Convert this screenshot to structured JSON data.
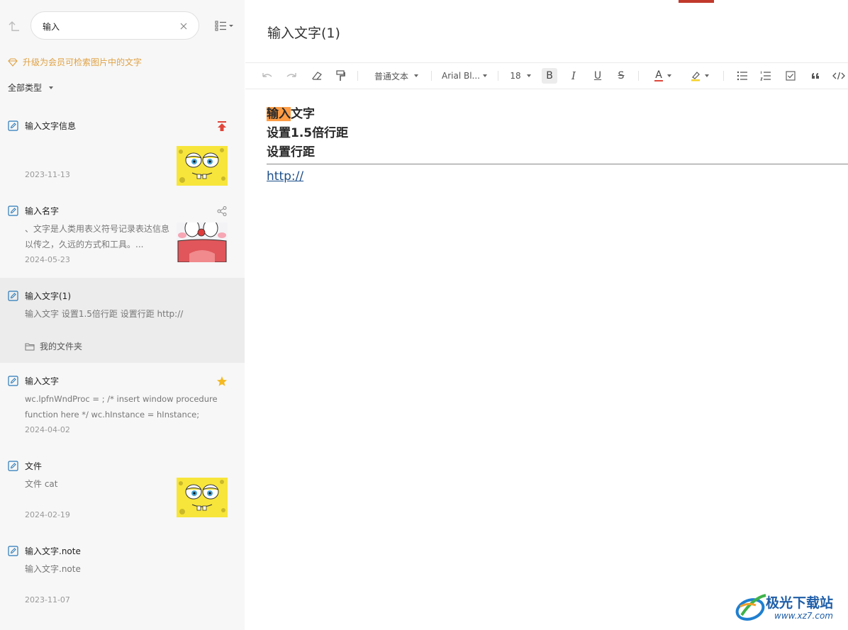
{
  "sidebar": {
    "search": {
      "value": "输入"
    },
    "upgrade_text": "升级为会员可检索图片中的文字",
    "type_filter": "全部类型",
    "notes": [
      {
        "title": "输入文字信息",
        "snippet": "",
        "date": "2023-11-13",
        "thumb": "spongebob",
        "badge": "pin-top-icon"
      },
      {
        "title": "输入名字",
        "snippet": "、文字是人类用表义符号记录表达信息以传之，久远的方式和工具。...",
        "date": "2024-05-23",
        "thumb": "doraemon",
        "badge": "share-icon"
      },
      {
        "title": "输入文字(1)",
        "snippet": "输入文字 设置1.5倍行距 设置行距 http://",
        "folder": "我的文件夹",
        "selected": true
      },
      {
        "title": "输入文字",
        "snippet": "wc.lpfnWndProc = ; /* insert window procedure function here */ wc.hInstance = hInstance; wc.h...",
        "date": "2024-04-02",
        "badge": "star-icon"
      },
      {
        "title": "文件",
        "snippet": "文件 cat",
        "date": "2024-02-19",
        "thumb": "spongebob"
      },
      {
        "title": "输入文字.note",
        "snippet": "输入文字.note",
        "date": "2023-11-07"
      }
    ]
  },
  "editor": {
    "title": "输入文字(1)",
    "toolbar": {
      "paragraph_style": "普通文本",
      "font_family": "Arial Bl...",
      "font_size": "18",
      "bold": "B",
      "italic": "I",
      "underline": "U",
      "strike": "S",
      "font_color": "A"
    },
    "content": {
      "line1_highlight": "输入",
      "line1_rest": "文字",
      "line2": "设置1.5倍行距",
      "line3": "设置行距",
      "link": "http://"
    }
  },
  "watermark": {
    "text": "极光下载站",
    "url": "www.xz7.com"
  },
  "colors": {
    "accent_orange": "#e0a143",
    "highlight": "#ff9d45",
    "icon_blue": "#2a7ab8",
    "pin_red": "#e0463a",
    "star": "#f5b921"
  }
}
